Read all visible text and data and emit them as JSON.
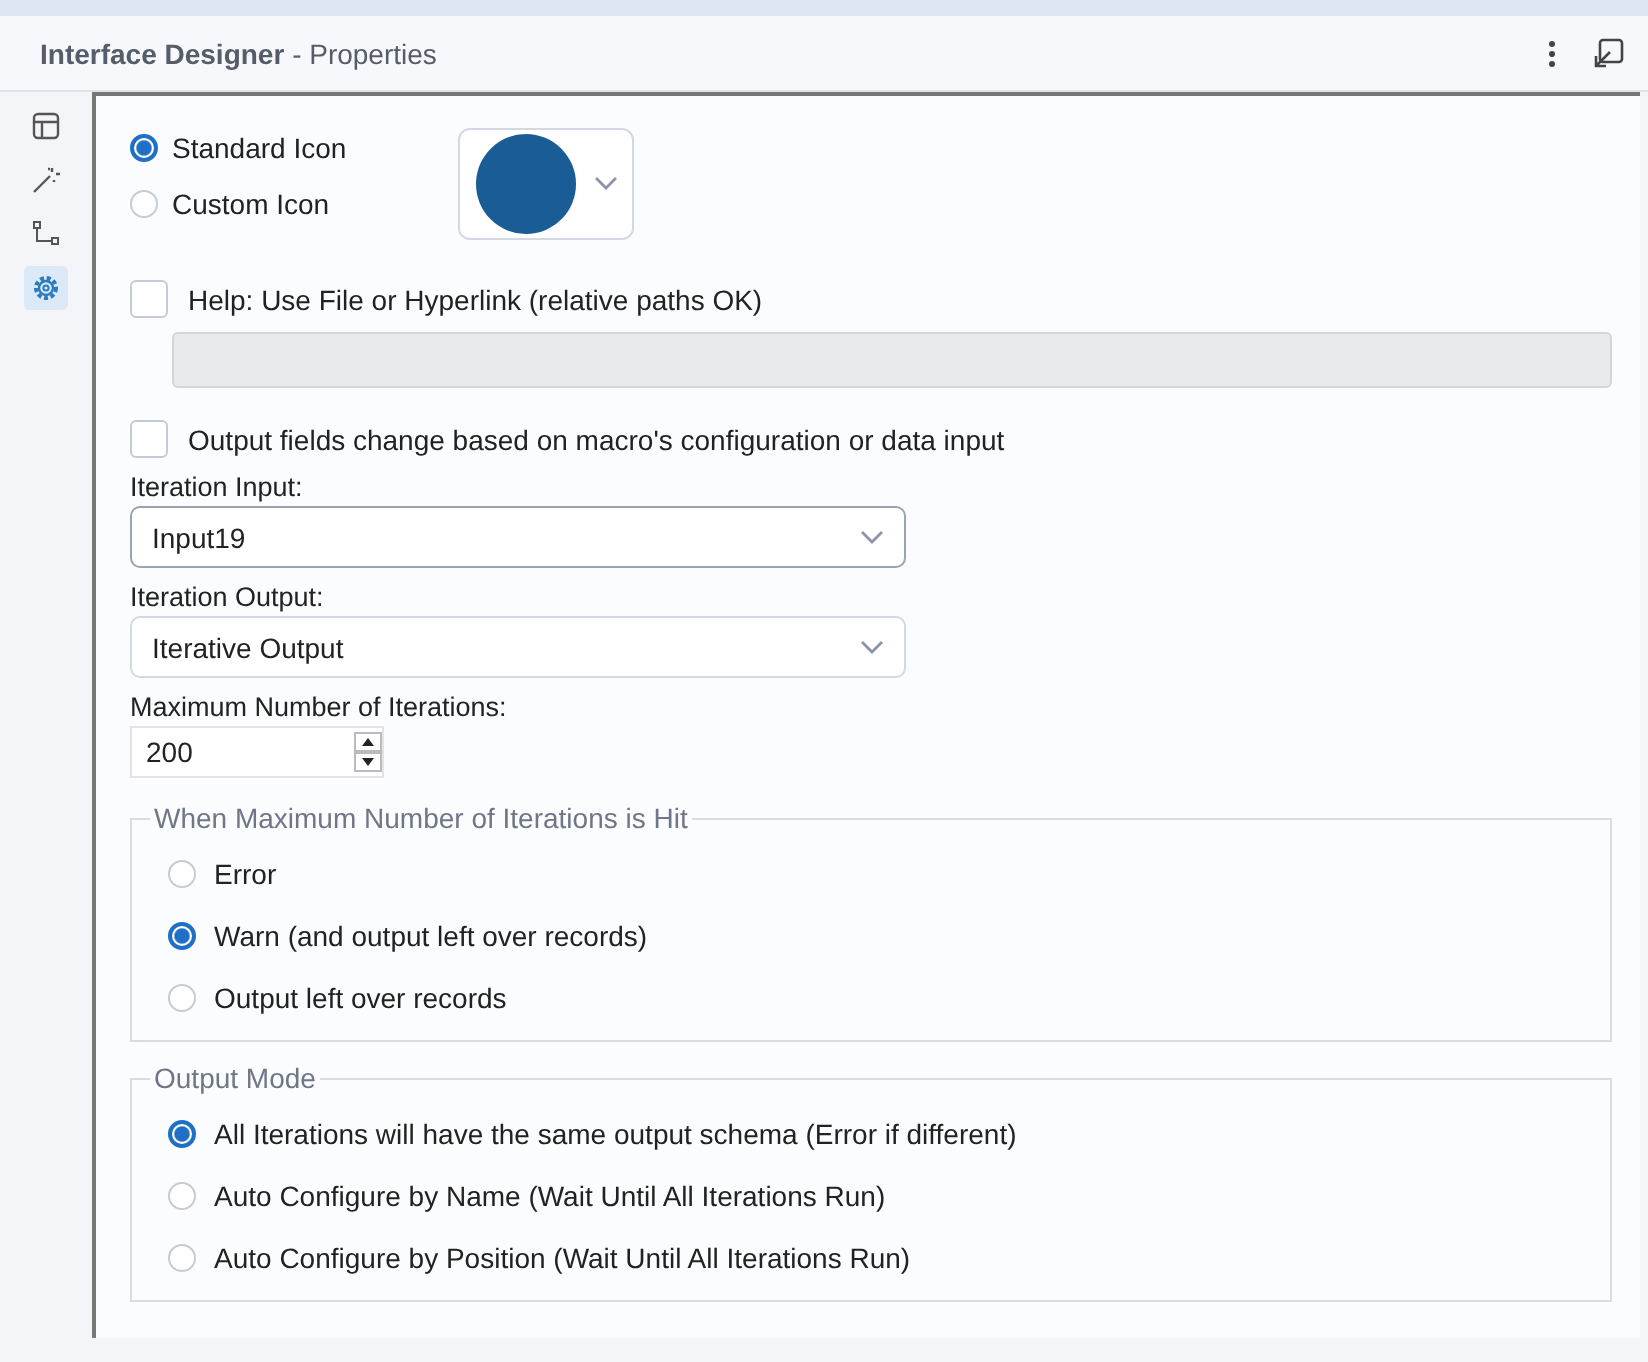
{
  "header": {
    "title": "Interface Designer",
    "subtitle": "- Properties"
  },
  "sidebar": {
    "items": [
      {
        "kind": "layout",
        "selected": false
      },
      {
        "kind": "wand",
        "selected": false
      },
      {
        "kind": "tree",
        "selected": false
      },
      {
        "kind": "gear",
        "selected": true
      }
    ]
  },
  "icon_choice": [
    {
      "label": "Standard Icon",
      "selected": true
    },
    {
      "label": "Custom Icon",
      "selected": false
    }
  ],
  "icon_swatch": {
    "color": "#1a5c96"
  },
  "help": {
    "label": "Help: Use File or Hyperlink (relative paths OK)",
    "checked": false
  },
  "output_fields": {
    "label": "Output fields change based on macro's configuration or data input",
    "checked": false
  },
  "iteration_input": {
    "label": "Iteration Input:",
    "value": "Input19"
  },
  "iteration_output": {
    "label": "Iteration Output:",
    "value": "Iterative Output"
  },
  "max_iterations": {
    "label": "Maximum Number of Iterations:",
    "value": "200"
  },
  "max_hit_group": {
    "title": "When Maximum Number of Iterations is Hit",
    "options": [
      {
        "label": "Error",
        "selected": false
      },
      {
        "label": "Warn (and output left over records)",
        "selected": true
      },
      {
        "label": "Output left over records",
        "selected": false
      }
    ]
  },
  "output_mode_group": {
    "title": "Output Mode",
    "options": [
      {
        "label": "All Iterations will have the same output schema (Error if different)",
        "selected": true
      },
      {
        "label": "Auto Configure by Name (Wait Until All Iterations Run)",
        "selected": false
      },
      {
        "label": "Auto Configure by Position (Wait Until All Iterations Run)",
        "selected": false
      }
    ]
  }
}
